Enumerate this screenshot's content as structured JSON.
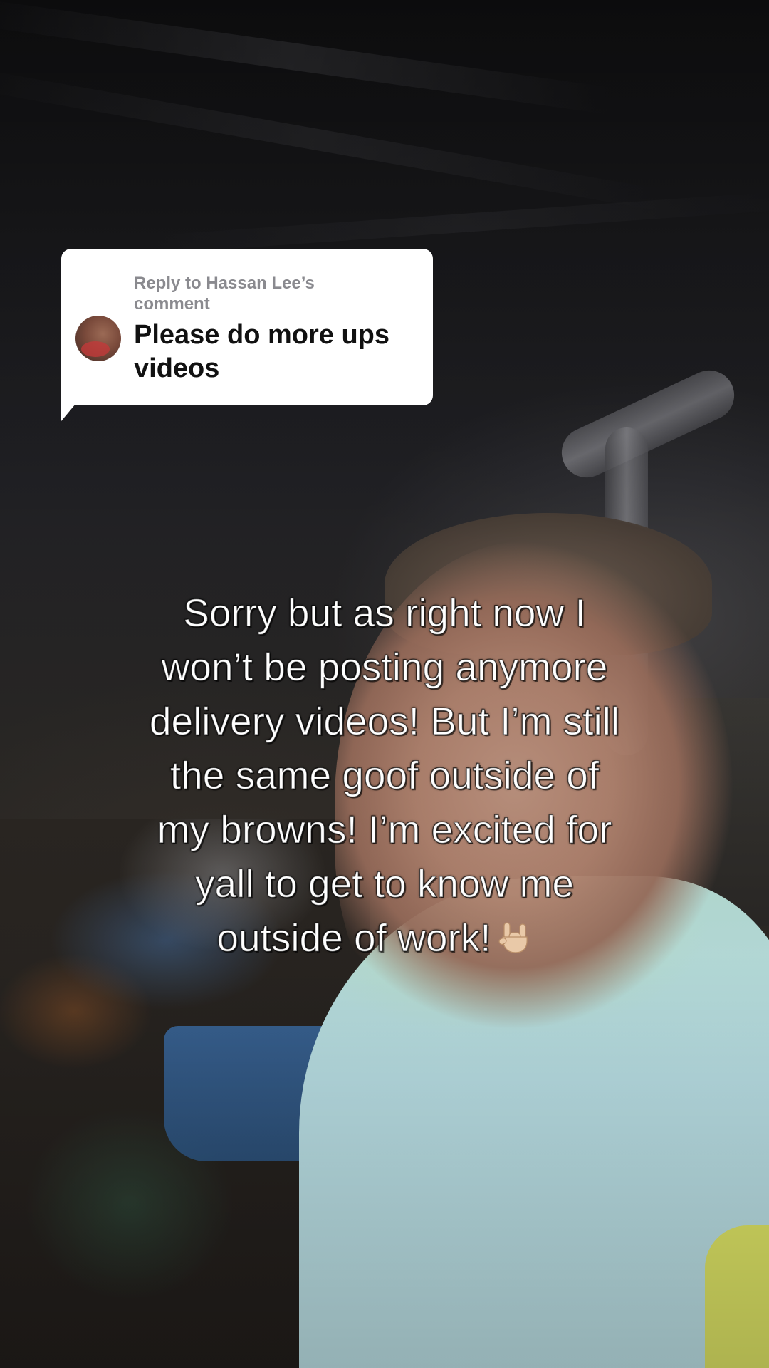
{
  "comment_reply": {
    "header_line1": "Reply to Hassan Lee’s",
    "header_line2": "comment",
    "text": "Please do more ups videos",
    "avatar_icon": "user-avatar-icon"
  },
  "caption": {
    "lines": [
      "Sorry but as right now I",
      "won’t be posting anymore",
      "delivery videos! But I’m still",
      "the same goof outside of",
      "my browns! I’m excited for",
      "yall to get to know me",
      "outside of work!"
    ],
    "trailing_emoji": "🤟🏼",
    "trailing_emoji_icon": "rock-on-hand-icon"
  },
  "colors": {
    "bubble_background": "#ffffff",
    "bubble_header_text": "#8a8a8f",
    "bubble_body_text": "#111111",
    "caption_text": "#ffffff"
  }
}
